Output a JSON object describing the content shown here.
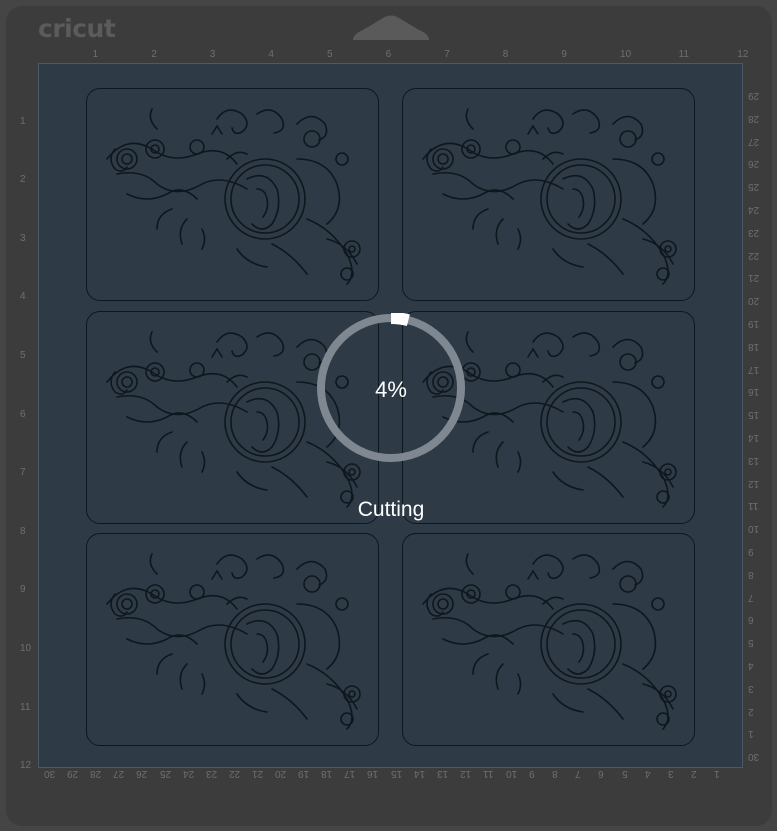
{
  "brand": {
    "logo_text": "cricut"
  },
  "rulers": {
    "top": [
      "1",
      "2",
      "3",
      "4",
      "5",
      "6",
      "7",
      "8",
      "9",
      "10",
      "11",
      "12"
    ],
    "left": [
      "1",
      "2",
      "3",
      "4",
      "5",
      "6",
      "7",
      "8",
      "9",
      "10",
      "11",
      "12"
    ],
    "right": [
      "29",
      "28",
      "27",
      "26",
      "25",
      "24",
      "23",
      "22",
      "21",
      "20",
      "19",
      "18",
      "17",
      "16",
      "15",
      "14",
      "13",
      "12",
      "11",
      "10",
      "9",
      "8",
      "7",
      "6",
      "5",
      "4",
      "3",
      "2",
      "1",
      "30"
    ],
    "bottom": [
      "30",
      "29",
      "28",
      "27",
      "26",
      "25",
      "24",
      "23",
      "22",
      "21",
      "20",
      "19",
      "18",
      "17",
      "16",
      "15",
      "14",
      "13",
      "12",
      "11",
      "10",
      "9",
      "8",
      "7",
      "6",
      "5",
      "4",
      "3",
      "2",
      "1"
    ]
  },
  "progress": {
    "percent_label": "4%",
    "fraction": 0.04,
    "status_label": "Cutting"
  },
  "colors": {
    "mat_background": "#3c3c3c",
    "cut_area": "#2e3a45",
    "progress_track": "#7f8890",
    "progress_fill": "#ffffff",
    "ornament_stroke": "#0f171e"
  },
  "mat_items": [
    {
      "icon": "flourish-ornament-icon"
    },
    {
      "icon": "flourish-ornament-icon"
    },
    {
      "icon": "flourish-ornament-icon"
    },
    {
      "icon": "flourish-ornament-icon"
    },
    {
      "icon": "flourish-ornament-icon"
    },
    {
      "icon": "flourish-ornament-icon"
    }
  ]
}
